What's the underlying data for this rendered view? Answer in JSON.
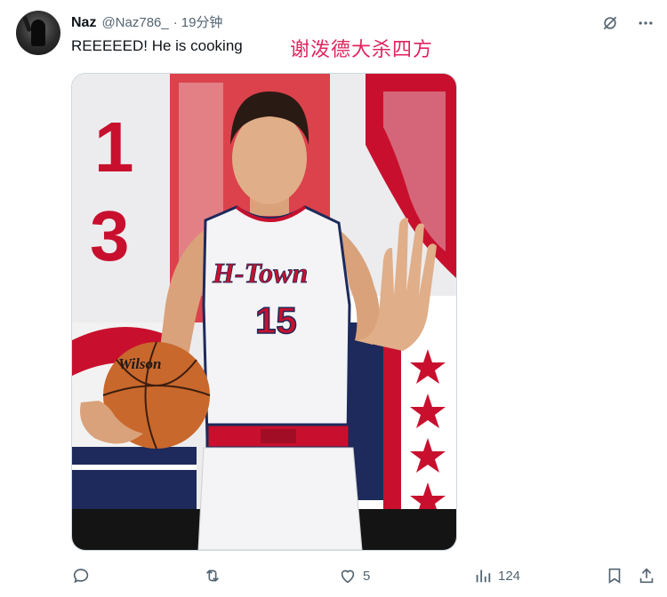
{
  "tweet": {
    "author_name": "Naz",
    "author_handle": "@Naz786_",
    "separator": "·",
    "time": "19分钟",
    "text": "REEEEED! He is cooking",
    "overlay_text": "谢泼德大杀四方"
  },
  "media": {
    "jersey_wordmark": "H-Town",
    "jersey_number": "15",
    "ball_brand": "Wilson",
    "background_numbers": [
      "1",
      "3"
    ]
  },
  "actions": {
    "reply_count": "",
    "retweet_count": "",
    "like_count": "5",
    "views_count": "124"
  },
  "colors": {
    "accent": "#e0245e",
    "muted": "#536471",
    "jersey_red": "#c8102e",
    "jersey_navy": "#1d2a5b"
  },
  "icons": {
    "grok": "grok-icon",
    "more": "more-icon",
    "reply": "reply-icon",
    "retweet": "retweet-icon",
    "like": "heart-icon",
    "views": "views-icon",
    "bookmark": "bookmark-icon",
    "share": "share-icon"
  }
}
